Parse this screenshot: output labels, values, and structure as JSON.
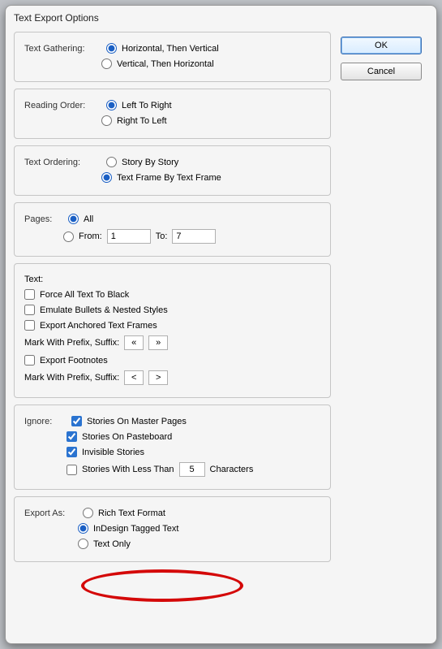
{
  "dialog": {
    "title": "Text Export Options"
  },
  "buttons": {
    "ok": "OK",
    "cancel": "Cancel"
  },
  "textGathering": {
    "label": "Text Gathering:",
    "opt1": "Horizontal, Then Vertical",
    "opt2": "Vertical, Then Horizontal"
  },
  "readingOrder": {
    "label": "Reading Order:",
    "opt1": "Left To Right",
    "opt2": "Right To Left"
  },
  "textOrdering": {
    "label": "Text Ordering:",
    "opt1": "Story By Story",
    "opt2": "Text Frame By Text Frame"
  },
  "pages": {
    "label": "Pages:",
    "all": "All",
    "from": "From:",
    "fromVal": "1",
    "to": "To:",
    "toVal": "7"
  },
  "text": {
    "label": "Text:",
    "forceBlack": "Force All Text To Black",
    "emulate": "Emulate Bullets & Nested Styles",
    "anchored": "Export Anchored Text Frames",
    "markPrefix": "Mark With Prefix, Suffix:",
    "pfx1": "«",
    "sfx1": "»",
    "footnotes": "Export Footnotes",
    "pfx2": "<",
    "sfx2": ">"
  },
  "ignore": {
    "label": "Ignore:",
    "master": "Stories On Master Pages",
    "pasteboard": "Stories On Pasteboard",
    "invisible": "Invisible Stories",
    "less": "Stories With Less Than",
    "lessVal": "5",
    "chars": "Characters"
  },
  "exportAs": {
    "label": "Export As:",
    "rtf": "Rich Text Format",
    "tagged": "InDesign Tagged Text",
    "textonly": "Text Only"
  }
}
